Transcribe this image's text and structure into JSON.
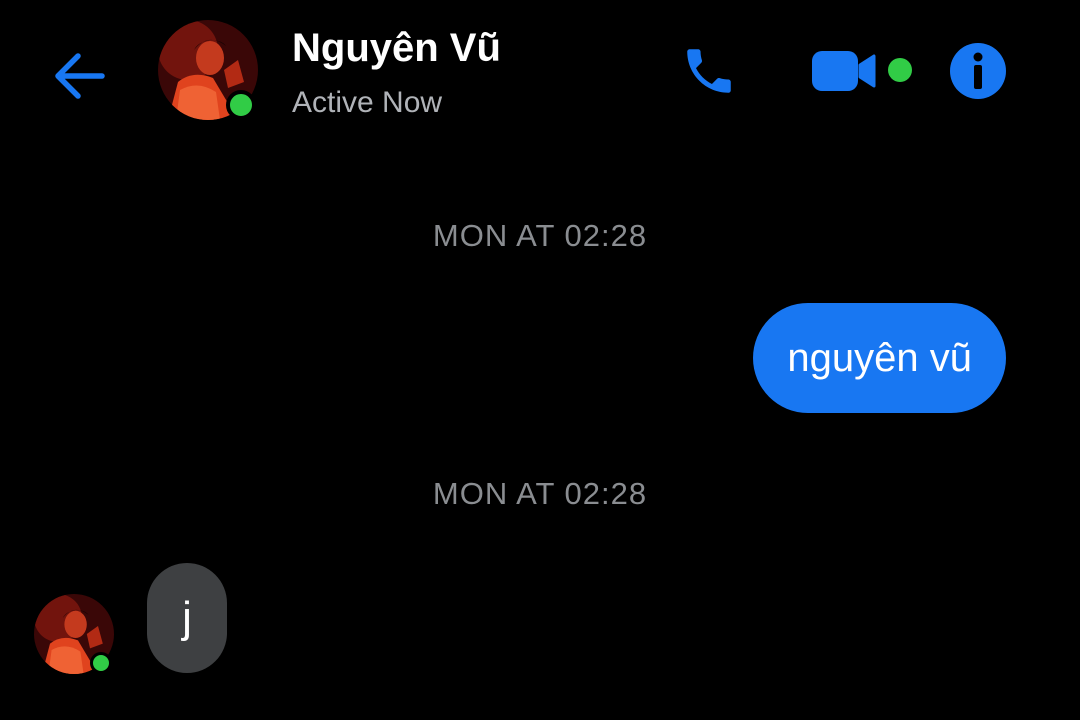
{
  "header": {
    "contact_name": "Nguyên Vũ",
    "status": "Active Now",
    "icons": {
      "back": "arrow-left-icon",
      "call": "phone-icon",
      "video": "video-camera-icon",
      "info": "info-icon"
    }
  },
  "colors": {
    "accent": "#1877f2",
    "online": "#31cc46",
    "incoming_bubble": "#3e4042",
    "timestamp": "#8a8d91"
  },
  "messages": [
    {
      "type": "timestamp",
      "text": "MON AT 02:28"
    },
    {
      "type": "outgoing",
      "text": "nguyên vũ"
    },
    {
      "type": "timestamp",
      "text": "MON AT 02:28"
    },
    {
      "type": "incoming",
      "text": "j"
    }
  ]
}
